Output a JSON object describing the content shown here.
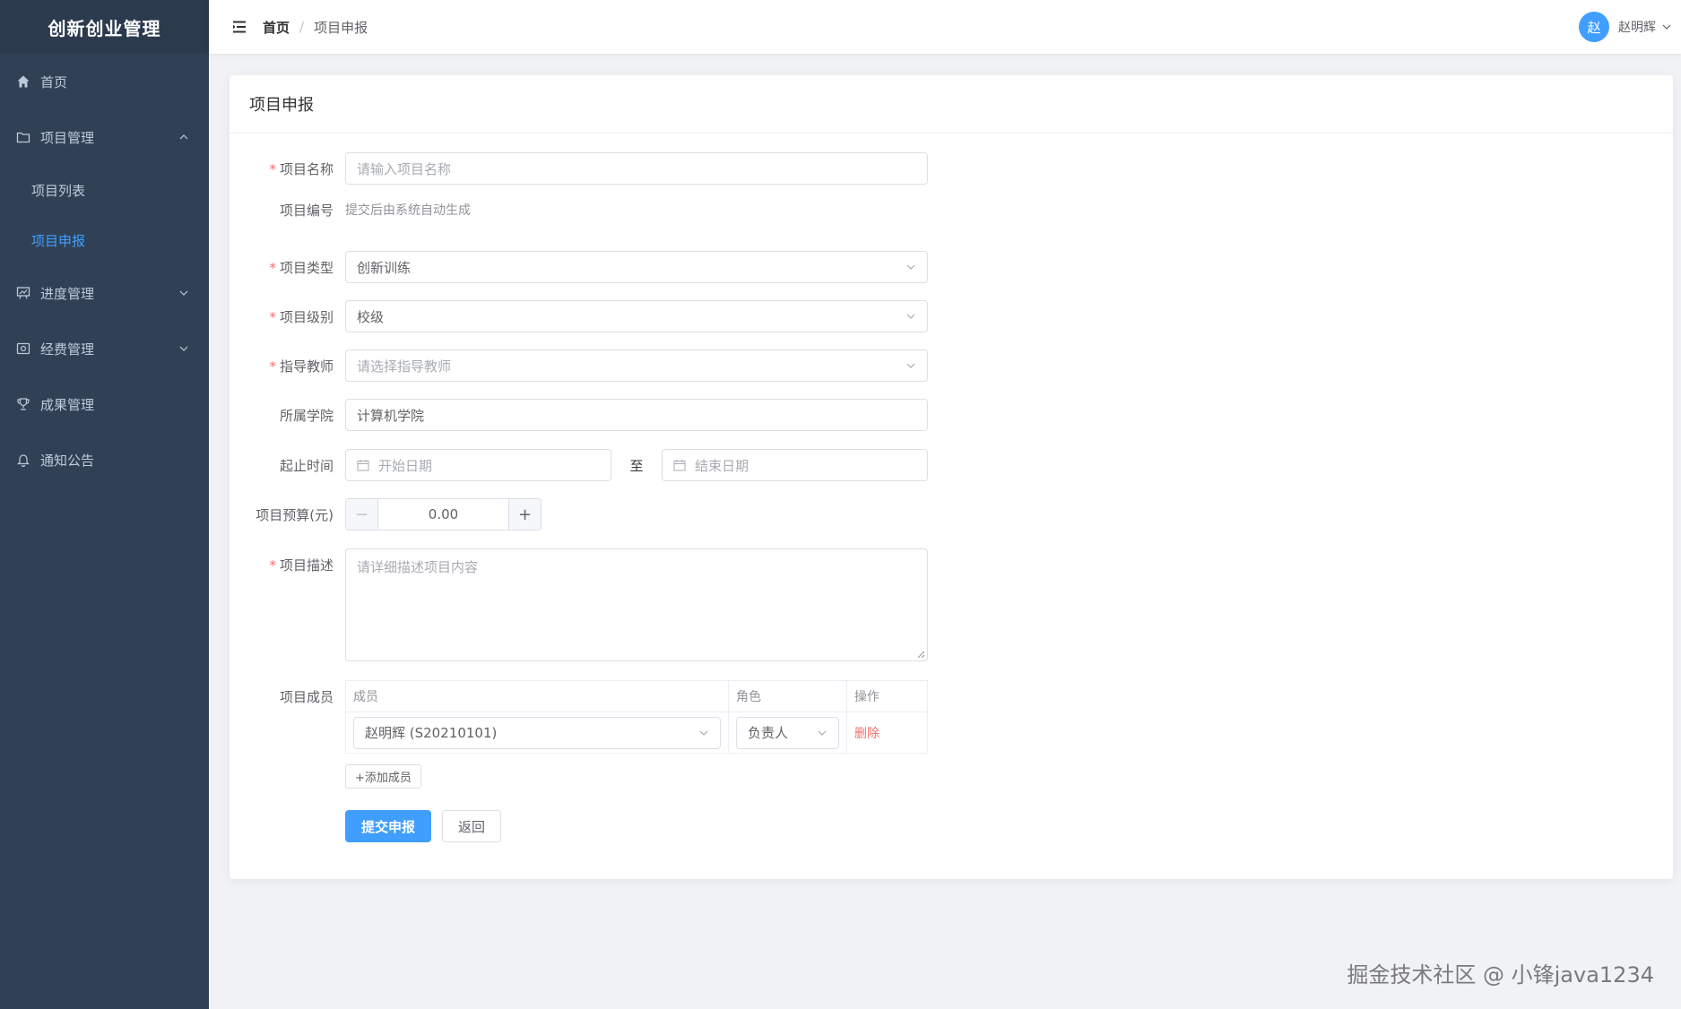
{
  "sidebar": {
    "logo": "创新创业管理",
    "items": [
      {
        "label": "首页",
        "icon": "home-icon"
      },
      {
        "label": "项目管理",
        "icon": "folder-icon"
      },
      {
        "label": "进度管理",
        "icon": "presentation-icon"
      },
      {
        "label": "经费管理",
        "icon": "money-icon"
      },
      {
        "label": "成果管理",
        "icon": "trophy-icon"
      },
      {
        "label": "通知公告",
        "icon": "bell-icon"
      }
    ],
    "sub_items": [
      {
        "label": "项目列表"
      },
      {
        "label": "项目申报"
      }
    ],
    "active_color": "#409eff"
  },
  "header": {
    "breadcrumb_home": "首页",
    "breadcrumb_sep": "/",
    "breadcrumb_current": "项目申报",
    "avatar_text": "赵",
    "user_name": "赵明辉"
  },
  "card": {
    "title": "项目申报"
  },
  "form": {
    "name": {
      "label": "项目名称",
      "placeholder": "请输入项目名称"
    },
    "code": {
      "label": "项目编号",
      "value": "提交后由系统自动生成"
    },
    "type": {
      "label": "项目类型",
      "value": "创新训练"
    },
    "level": {
      "label": "项目级别",
      "value": "校级"
    },
    "teacher": {
      "label": "指导教师",
      "placeholder": "请选择指导教师"
    },
    "college": {
      "label": "所属学院",
      "value": "计算机学院"
    },
    "period": {
      "label": "起止时间",
      "start_placeholder": "开始日期",
      "separator": "至",
      "end_placeholder": "结束日期"
    },
    "budget": {
      "label": "项目预算(元)",
      "value": "0.00",
      "minus": "−",
      "plus": "+"
    },
    "description": {
      "label": "项目描述",
      "placeholder": "请详细描述项目内容"
    },
    "members": {
      "label": "项目成员",
      "columns": [
        "成员",
        "角色",
        "操作"
      ],
      "rows": [
        {
          "member": "赵明辉 (S20210101)",
          "role": "负责人",
          "action": "删除"
        }
      ],
      "add_label": "+添加成员"
    },
    "submit_label": "提交申报",
    "back_label": "返回"
  },
  "watermark": "掘金技术社区 @ 小锋java1234"
}
